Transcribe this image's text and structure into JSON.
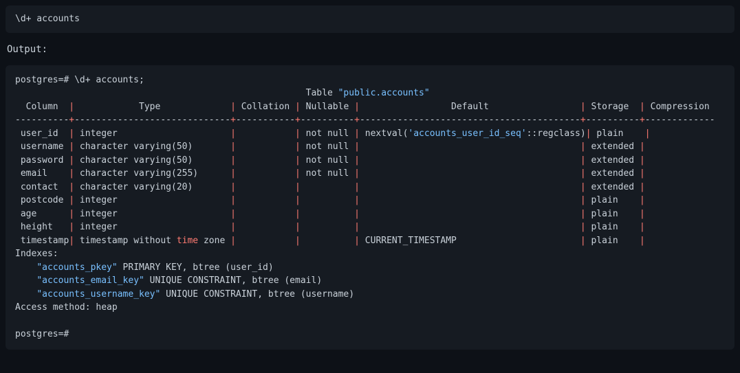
{
  "command": "\\d+ accounts",
  "output_label": "Output:",
  "prompt1": "postgres=# ",
  "echo_cmd": "\\d+ accounts;",
  "table_title_prefix": "Table ",
  "table_title_quoted": "\"public.accounts\"",
  "headers": {
    "column": "Column",
    "type": "Type",
    "collation": "Collation",
    "nullable": "Nullable",
    "default": "Default",
    "storage": "Storage",
    "compression": "Compression"
  },
  "rows": [
    {
      "column": "user_id",
      "type": "integer",
      "collation": "",
      "nullable": "not null",
      "default_pre": "nextval(",
      "default_str": "'accounts_user_id_seq'",
      "default_post": "::regclass)",
      "storage": "plain",
      "compression": ""
    },
    {
      "column": "username",
      "type": "character varying(50)",
      "collation": "",
      "nullable": "not null",
      "default_pre": "",
      "default_str": "",
      "default_post": "",
      "storage": "extended",
      "compression": ""
    },
    {
      "column": "password",
      "type": "character varying(50)",
      "collation": "",
      "nullable": "not null",
      "default_pre": "",
      "default_str": "",
      "default_post": "",
      "storage": "extended",
      "compression": ""
    },
    {
      "column": "email",
      "type": "character varying(255)",
      "collation": "",
      "nullable": "not null",
      "default_pre": "",
      "default_str": "",
      "default_post": "",
      "storage": "extended",
      "compression": ""
    },
    {
      "column": "contact",
      "type": "character varying(20)",
      "collation": "",
      "nullable": "",
      "default_pre": "",
      "default_str": "",
      "default_post": "",
      "storage": "extended",
      "compression": ""
    },
    {
      "column": "postcode",
      "type": "integer",
      "collation": "",
      "nullable": "",
      "default_pre": "",
      "default_str": "",
      "default_post": "",
      "storage": "plain",
      "compression": ""
    },
    {
      "column": "age",
      "type": "integer",
      "collation": "",
      "nullable": "",
      "default_pre": "",
      "default_str": "",
      "default_post": "",
      "storage": "plain",
      "compression": ""
    },
    {
      "column": "height",
      "type": "integer",
      "collation": "",
      "nullable": "",
      "default_pre": "",
      "default_str": "",
      "default_post": "",
      "storage": "plain",
      "compression": ""
    }
  ],
  "ts_row": {
    "column": "timestamp",
    "type_pre": "timestamp without ",
    "type_kw": "time",
    "type_post": " zone",
    "collation": "",
    "nullable": "",
    "default": "CURRENT_TIMESTAMP",
    "storage": "plain",
    "compression": ""
  },
  "indexes_label": "Indexes:",
  "indexes": [
    {
      "name": "\"accounts_pkey\"",
      "rest": " PRIMARY KEY, btree (user_id)"
    },
    {
      "name": "\"accounts_email_key\"",
      "rest": " UNIQUE CONSTRAINT, btree (email)"
    },
    {
      "name": "\"accounts_username_key\"",
      "rest": " UNIQUE CONSTRAINT, btree (username)"
    }
  ],
  "access_method": "Access method: heap",
  "prompt2": "postgres=# ",
  "widths": {
    "column": 10,
    "type": 29,
    "collation": 11,
    "nullable": 10,
    "default": 41,
    "storage": 10,
    "compression": 13
  }
}
